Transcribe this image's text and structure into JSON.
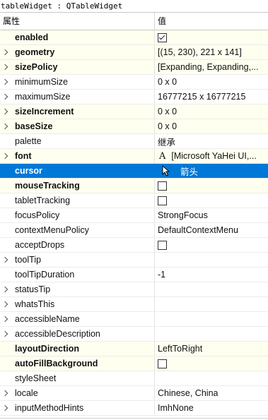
{
  "window": {
    "title": "tableWidget : QTableWidget"
  },
  "header": {
    "property_label": "属性",
    "value_label": "值"
  },
  "colors": {
    "selected": "#0078d7",
    "row_alt": "#fffff0"
  },
  "rows": [
    {
      "name": "enabled",
      "bold": true,
      "expandable": false,
      "value_type": "checkbox",
      "checked": true,
      "value": ""
    },
    {
      "name": "geometry",
      "bold": true,
      "expandable": true,
      "value_type": "text",
      "value": "[(15, 230), 221 x 141]"
    },
    {
      "name": "sizePolicy",
      "bold": true,
      "expandable": true,
      "value_type": "text",
      "value": "[Expanding, Expanding,..."
    },
    {
      "name": "minimumSize",
      "bold": false,
      "expandable": true,
      "value_type": "text",
      "value": "0 x 0"
    },
    {
      "name": "maximumSize",
      "bold": false,
      "expandable": true,
      "value_type": "text",
      "value": "16777215 x 16777215"
    },
    {
      "name": "sizeIncrement",
      "bold": true,
      "expandable": true,
      "value_type": "text",
      "value": "0 x 0"
    },
    {
      "name": "baseSize",
      "bold": true,
      "expandable": true,
      "value_type": "text",
      "value": "0 x 0"
    },
    {
      "name": "palette",
      "bold": false,
      "expandable": false,
      "value_type": "text",
      "value": "继承"
    },
    {
      "name": "font",
      "bold": true,
      "expandable": true,
      "value_type": "font",
      "icon": "font-A-icon",
      "value": "[Microsoft YaHei UI,..."
    },
    {
      "name": "cursor",
      "bold": true,
      "expandable": false,
      "selected": true,
      "value_type": "cursor",
      "icon": "arrow-cursor-icon",
      "value": "箭头"
    },
    {
      "name": "mouseTracking",
      "bold": true,
      "expandable": false,
      "value_type": "checkbox",
      "checked": false,
      "value": ""
    },
    {
      "name": "tabletTracking",
      "bold": false,
      "expandable": false,
      "value_type": "checkbox",
      "checked": false,
      "value": ""
    },
    {
      "name": "focusPolicy",
      "bold": false,
      "expandable": false,
      "value_type": "text",
      "value": "StrongFocus"
    },
    {
      "name": "contextMenuPolicy",
      "bold": false,
      "expandable": false,
      "value_type": "text",
      "value": "DefaultContextMenu"
    },
    {
      "name": "acceptDrops",
      "bold": false,
      "expandable": false,
      "value_type": "checkbox",
      "checked": false,
      "value": ""
    },
    {
      "name": "toolTip",
      "bold": false,
      "expandable": true,
      "value_type": "text",
      "value": ""
    },
    {
      "name": "toolTipDuration",
      "bold": false,
      "expandable": false,
      "value_type": "text",
      "value": "-1"
    },
    {
      "name": "statusTip",
      "bold": false,
      "expandable": true,
      "value_type": "text",
      "value": ""
    },
    {
      "name": "whatsThis",
      "bold": false,
      "expandable": true,
      "value_type": "text",
      "value": ""
    },
    {
      "name": "accessibleName",
      "bold": false,
      "expandable": true,
      "value_type": "text",
      "value": ""
    },
    {
      "name": "accessibleDescription",
      "bold": false,
      "expandable": true,
      "value_type": "text",
      "value": ""
    },
    {
      "name": "layoutDirection",
      "bold": true,
      "expandable": false,
      "value_type": "text",
      "value": "LeftToRight"
    },
    {
      "name": "autoFillBackground",
      "bold": true,
      "expandable": false,
      "value_type": "checkbox",
      "checked": false,
      "value": ""
    },
    {
      "name": "styleSheet",
      "bold": false,
      "expandable": false,
      "value_type": "text",
      "value": ""
    },
    {
      "name": "locale",
      "bold": false,
      "expandable": true,
      "value_type": "text",
      "value": "Chinese, China"
    },
    {
      "name": "inputMethodHints",
      "bold": false,
      "expandable": true,
      "value_type": "text",
      "value": "ImhNone"
    }
  ]
}
